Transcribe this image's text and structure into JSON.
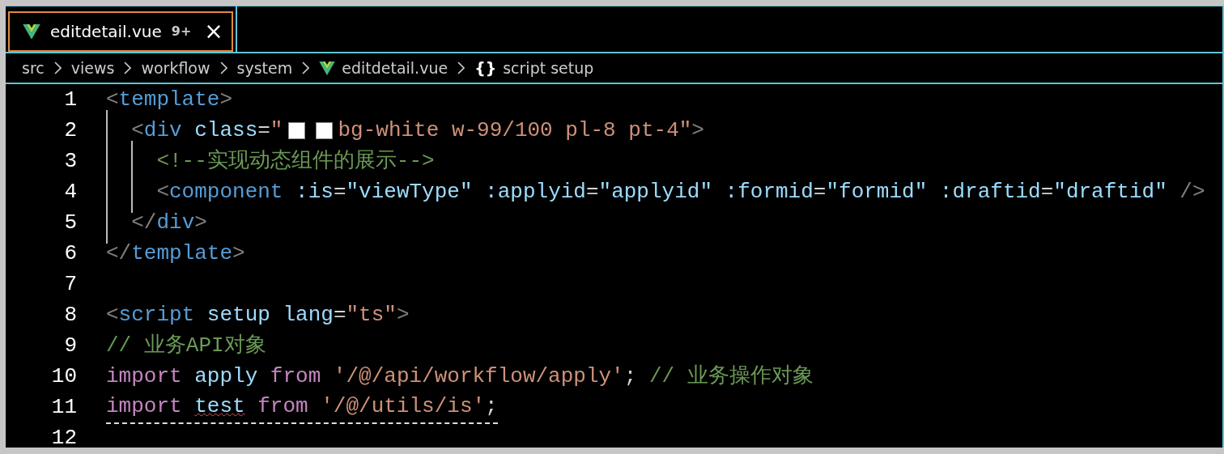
{
  "tabs": [
    {
      "label": "editdetail.vue",
      "badge": "9+",
      "close": "×",
      "selected": true
    }
  ],
  "breadcrumb": [
    {
      "label": "src"
    },
    {
      "label": "views"
    },
    {
      "label": "workflow"
    },
    {
      "label": "system"
    },
    {
      "label": "editdetail.vue",
      "kind": "vue"
    },
    {
      "label": "script setup",
      "kind": "symbol",
      "symbol": "{}"
    }
  ],
  "lines": [
    {
      "number": "1",
      "tokens": [
        {
          "kind": "punct",
          "text": "<"
        },
        {
          "kind": "tag",
          "text": "template"
        },
        {
          "kind": "punct",
          "text": ">"
        }
      ]
    },
    {
      "number": "2",
      "tokens": [
        {
          "kind": "punct",
          "text": "  <"
        },
        {
          "kind": "tag",
          "text": "div"
        },
        {
          "kind": "attr",
          "text": " class"
        },
        {
          "kind": "plain",
          "text": "="
        },
        {
          "kind": "string",
          "text": "\""
        },
        {
          "kind": "swatch",
          "color": "#ffffff"
        },
        {
          "kind": "swatch",
          "color": "#ffffff"
        },
        {
          "kind": "string",
          "text": "bg-white w-99/100 pl-8 pt-4\""
        },
        {
          "kind": "punct",
          "text": ">"
        }
      ]
    },
    {
      "number": "3",
      "tokens": [
        {
          "kind": "comment",
          "text": "    <!--实现动态组件的展示-->"
        }
      ]
    },
    {
      "number": "4",
      "tokens": [
        {
          "kind": "punct",
          "text": "    <"
        },
        {
          "kind": "tag",
          "text": "component"
        },
        {
          "kind": "attr",
          "text": " :is"
        },
        {
          "kind": "plain",
          "text": "="
        },
        {
          "kind": "attr",
          "text": "\"viewType\""
        },
        {
          "kind": "attr",
          "text": " :applyid"
        },
        {
          "kind": "plain",
          "text": "="
        },
        {
          "kind": "attr",
          "text": "\"applyid\""
        },
        {
          "kind": "attr",
          "text": " :formid"
        },
        {
          "kind": "plain",
          "text": "="
        },
        {
          "kind": "attr",
          "text": "\"formid\""
        },
        {
          "kind": "attr",
          "text": " :draftid"
        },
        {
          "kind": "plain",
          "text": "="
        },
        {
          "kind": "attr",
          "text": "\"draftid\""
        },
        {
          "kind": "punct",
          "text": " />"
        }
      ]
    },
    {
      "number": "5",
      "tokens": [
        {
          "kind": "punct",
          "text": "  </"
        },
        {
          "kind": "tag",
          "text": "div"
        },
        {
          "kind": "punct",
          "text": ">"
        }
      ]
    },
    {
      "number": "6",
      "tokens": [
        {
          "kind": "punct",
          "text": "</"
        },
        {
          "kind": "tag",
          "text": "template"
        },
        {
          "kind": "punct",
          "text": ">"
        }
      ]
    },
    {
      "number": "7"
    },
    {
      "number": "8",
      "tokens": [
        {
          "kind": "punct",
          "text": "<"
        },
        {
          "kind": "tag",
          "text": "script"
        },
        {
          "kind": "attr",
          "text": " setup"
        },
        {
          "kind": "attr",
          "text": " lang"
        },
        {
          "kind": "plain",
          "text": "="
        },
        {
          "kind": "string",
          "text": "\"ts\""
        },
        {
          "kind": "punct",
          "text": ">"
        }
      ]
    },
    {
      "number": "9",
      "tokens": [
        {
          "kind": "comment",
          "text": "// 业务API对象"
        }
      ]
    },
    {
      "number": "10",
      "tokens": [
        {
          "kind": "keyword",
          "text": "import"
        },
        {
          "kind": "ident",
          "text": " apply"
        },
        {
          "kind": "keyword",
          "text": " from"
        },
        {
          "kind": "string",
          "text": " '/@/api/workflow/apply'"
        },
        {
          "kind": "plain",
          "text": ";"
        },
        {
          "kind": "comment",
          "text": " // 业务操作对象"
        }
      ]
    },
    {
      "number": "11",
      "underlined": true,
      "tokens": [
        {
          "kind": "keyword",
          "text": "import "
        },
        {
          "kind": "ident",
          "text": "test",
          "error": true
        },
        {
          "kind": "keyword",
          "text": " from"
        },
        {
          "kind": "string",
          "text": " '/@/utils/is'"
        },
        {
          "kind": "plain",
          "text": ";"
        }
      ]
    },
    {
      "number": "12"
    }
  ]
}
